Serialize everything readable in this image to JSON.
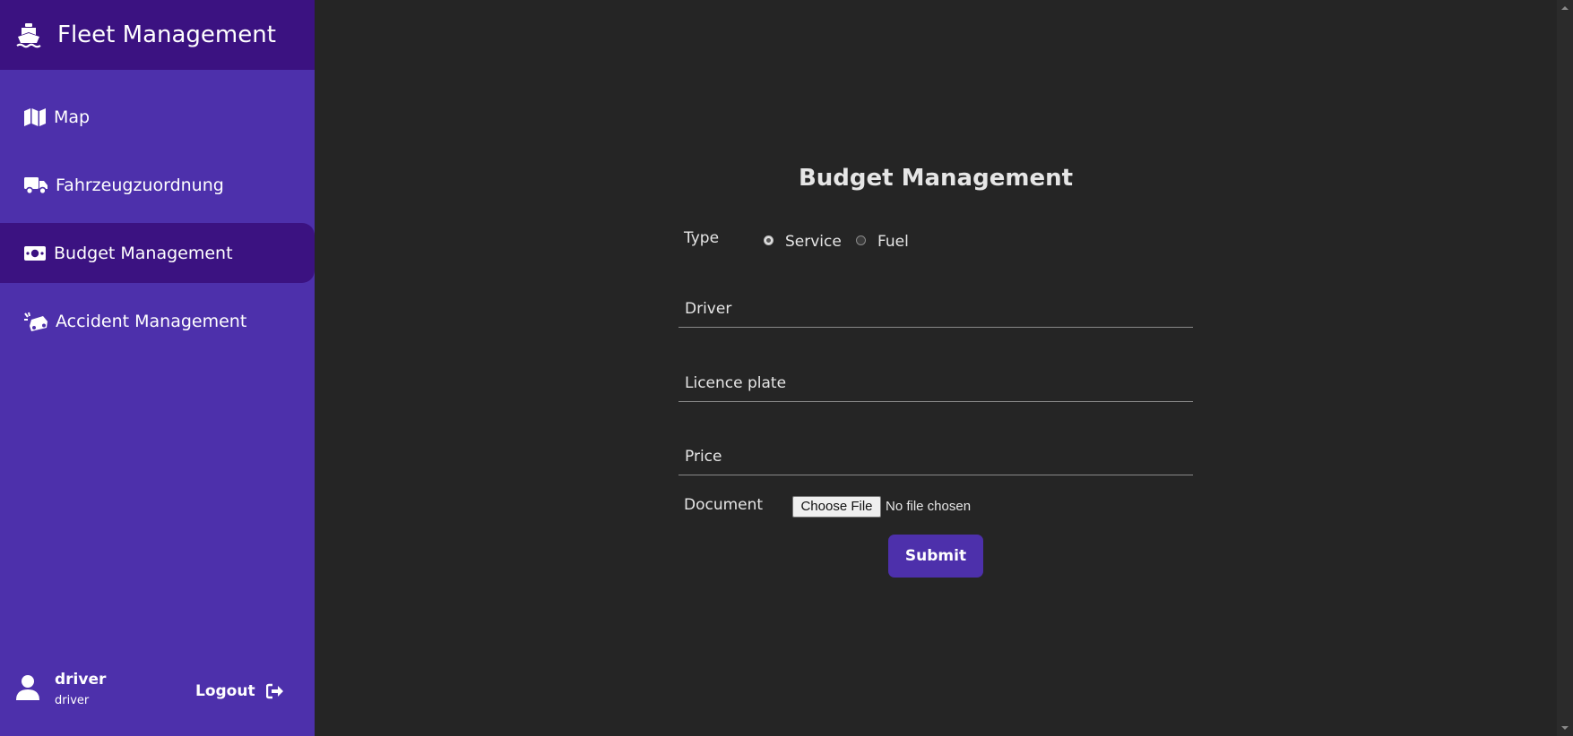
{
  "app": {
    "title": "Fleet Management",
    "brand_icon": "ship-icon"
  },
  "sidebar": {
    "items": [
      {
        "label": "Map",
        "icon": "map-icon",
        "active": false
      },
      {
        "label": "Fahrzeugzuordnung",
        "icon": "truck-icon",
        "active": false
      },
      {
        "label": "Budget Management",
        "icon": "money-bill-icon",
        "active": true
      },
      {
        "label": "Accident Management",
        "icon": "car-crash-icon",
        "active": false
      }
    ],
    "user": {
      "name": "driver",
      "role": "driver",
      "icon": "user-icon"
    },
    "logout_label": "Logout",
    "logout_icon": "sign-out-icon"
  },
  "form": {
    "title": "Budget Management",
    "type_label": "Type",
    "type_options": [
      {
        "label": "Service",
        "checked": true
      },
      {
        "label": "Fuel",
        "checked": false
      }
    ],
    "driver_placeholder": "Driver",
    "licence_plate_placeholder": "Licence plate",
    "price_placeholder": "Price",
    "document_label": "Document",
    "file_button_label": "Choose File",
    "file_status": "No file chosen",
    "submit_label": "Submit"
  },
  "colors": {
    "sidebar_bg": "#4d30ab",
    "sidebar_header_bg": "#3b1281",
    "active_item_bg": "#3b1281",
    "main_bg": "#252525",
    "button_bg": "#4d30ab",
    "text_light": "#e6e6e6"
  }
}
